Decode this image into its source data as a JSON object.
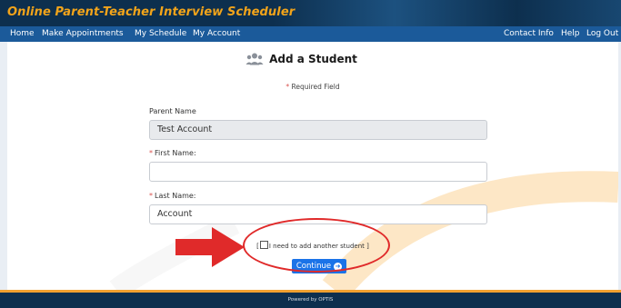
{
  "app": {
    "title": "Online Parent-Teacher Interview Scheduler"
  },
  "nav": {
    "left": [
      "Home",
      "Make Appointments",
      "My Schedule",
      "My Account"
    ],
    "right": [
      "Contact Info",
      "Help",
      "Log Out"
    ]
  },
  "page": {
    "heading": "Add a Student",
    "heading_icon": "users-icon",
    "required_star": "*",
    "required_note": "Required Field"
  },
  "form": {
    "parent_name_label": "Parent Name",
    "parent_name_value": "Test Account",
    "first_name_label": "First Name:",
    "first_name_value": "",
    "last_name_label": "Last Name:",
    "last_name_value": "Account",
    "add_another_text": "I need to add another student",
    "add_another_checked": false,
    "continue_label": "Continue"
  },
  "footer": {
    "powered_by": "Powered by OPTIS"
  },
  "colors": {
    "header_bg": "#0d2f4e",
    "title": "#f2a41a",
    "nav_bg": "#1b5a9a",
    "accent_button": "#1a73e8",
    "required_star": "#d9534f",
    "annotation_red": "#e02a2a"
  }
}
